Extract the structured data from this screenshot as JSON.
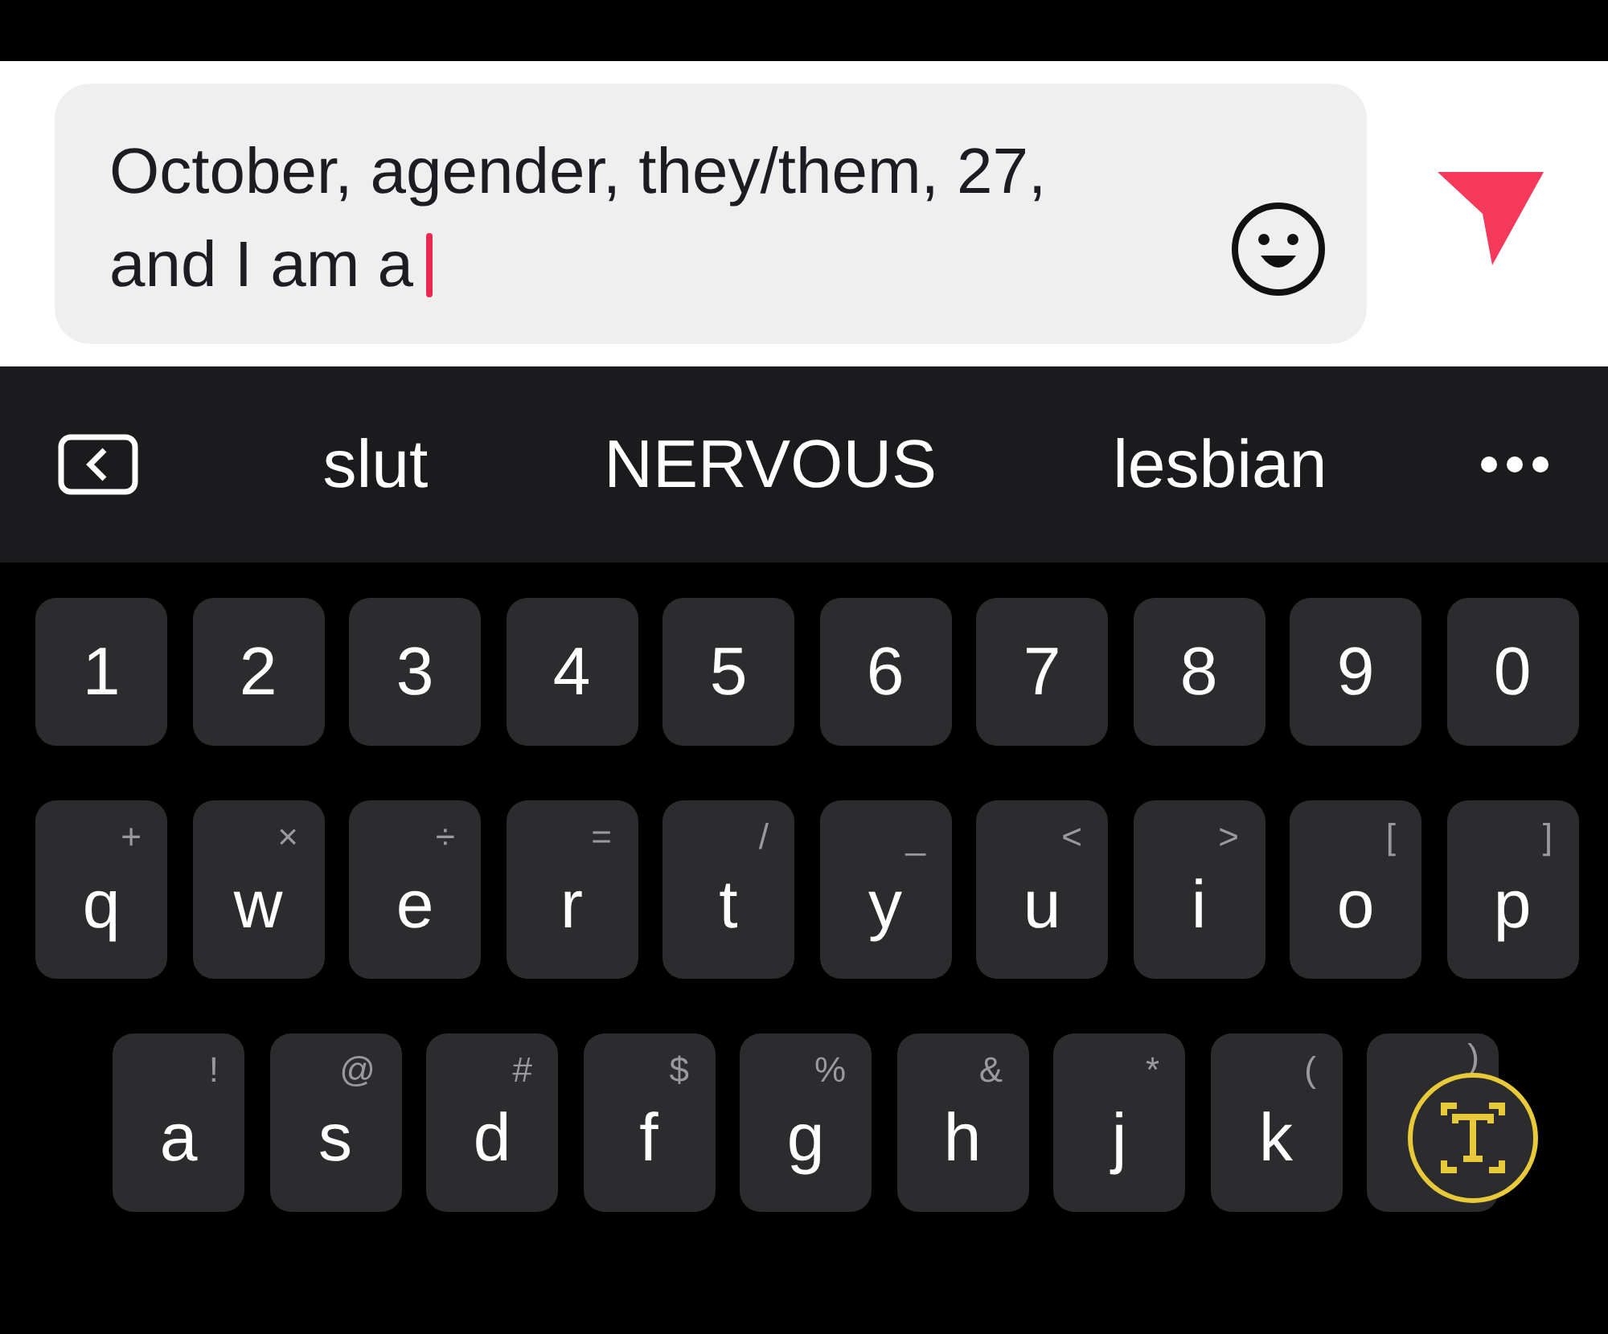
{
  "message_field": {
    "lines": [
      "October, agender, they/them, 27,",
      "and I am a"
    ]
  },
  "suggestions": [
    "slut",
    "NERVOUS",
    "lesbian"
  ],
  "keyboard": {
    "rows": [
      [
        {
          "letter": "1"
        },
        {
          "letter": "2"
        },
        {
          "letter": "3"
        },
        {
          "letter": "4"
        },
        {
          "letter": "5"
        },
        {
          "letter": "6"
        },
        {
          "letter": "7"
        },
        {
          "letter": "8"
        },
        {
          "letter": "9"
        },
        {
          "letter": "0"
        }
      ],
      [
        {
          "letter": "q",
          "hint": "+"
        },
        {
          "letter": "w",
          "hint": "×"
        },
        {
          "letter": "e",
          "hint": "÷"
        },
        {
          "letter": "r",
          "hint": "="
        },
        {
          "letter": "t",
          "hint": "/"
        },
        {
          "letter": "y",
          "hint": "_"
        },
        {
          "letter": "u",
          "hint": "<"
        },
        {
          "letter": "i",
          "hint": ">"
        },
        {
          "letter": "o",
          "hint": "["
        },
        {
          "letter": "p",
          "hint": "]"
        }
      ],
      [
        {
          "letter": "a",
          "hint": "!"
        },
        {
          "letter": "s",
          "hint": "@"
        },
        {
          "letter": "d",
          "hint": "#"
        },
        {
          "letter": "f",
          "hint": "$"
        },
        {
          "letter": "g",
          "hint": "%"
        },
        {
          "letter": "h",
          "hint": "&"
        },
        {
          "letter": "j",
          "hint": "*"
        },
        {
          "letter": "k",
          "hint": "("
        },
        {
          "hint": ")"
        }
      ]
    ]
  }
}
